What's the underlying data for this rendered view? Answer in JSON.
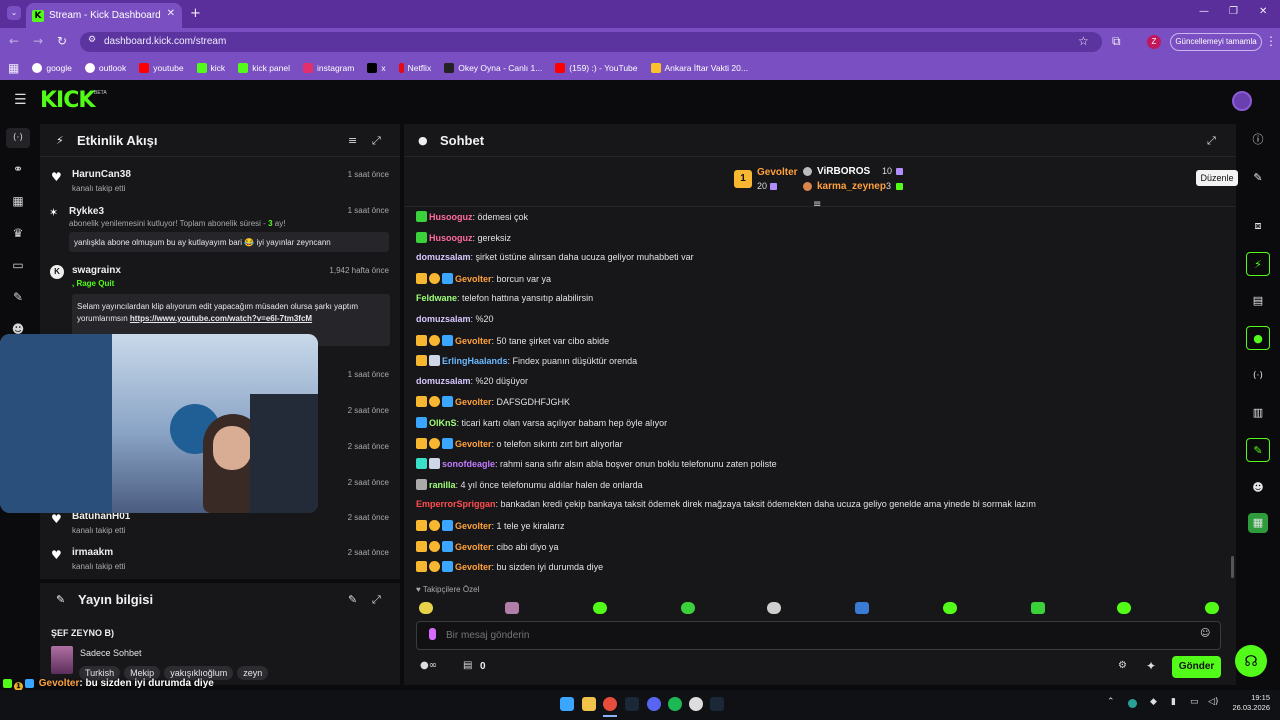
{
  "browser": {
    "tab_title": "Stream - Kick Dashboard",
    "url": "dashboard.kick.com/stream",
    "profile_initial": "Z",
    "update_label": "Güncellemeyi tamamla",
    "bookmarks": [
      "google",
      "outlook",
      "youtube",
      "kick",
      "kick panel",
      "instagram",
      "x",
      "Netflix",
      "Okey Oyna - Canlı 1...",
      "(159) :) - YouTube",
      "Ankara İftar Vakti 20..."
    ]
  },
  "brand": {
    "logo": "KICK",
    "beta": "BETA"
  },
  "activity": {
    "title": "Etkinlik Akışı",
    "events": [
      {
        "name": "HarunCan38",
        "sub": "kanalı takip etti",
        "time": "1 saat önce"
      },
      {
        "name": "Rykke3",
        "sub": "abonelik yenilemesini kutluyor! Toplam abonelik süresi - ",
        "sub_strong": "3",
        "sub_end": " ay!",
        "time": "1 saat önce",
        "message": "yanlışkla abone olmuşum bu ay kutlayayım bari 😂 iyi yayınlar zeyncann"
      },
      {
        "name": "swagrainx",
        "sub": ", Rage Quit",
        "time": "1,942 hafta önce",
        "message": "Selam yayıncılardan klip alıyorum edit yapacağım müsaden olursa şarkı yaptım yorumlarımsın ",
        "link": "https://www.youtube.com/watch?v=e6l-7tm3fcM"
      },
      {
        "time": "1 saat önce"
      },
      {
        "time": "2 saat önce"
      },
      {
        "time": "2 saat önce"
      },
      {
        "time": "2 saat önce"
      },
      {
        "name": "BatuhanH01",
        "sub": "kanalı takip etti",
        "time": "2 saat önce"
      },
      {
        "name": "irmaakm",
        "sub": "kanalı takip etti",
        "time": "2 saat önce"
      }
    ]
  },
  "stream_info": {
    "title": "Yayın bilgisi",
    "stream_title": "ŞEF ZEYNO B)",
    "category": "Sadece Sohbet",
    "tags": [
      "Turkish",
      "Mekip",
      "yakışıklıoğlum",
      "zeyn"
    ]
  },
  "chat": {
    "title": "Sohbet",
    "top": {
      "gifter1": "Gevolter",
      "gifter1_count": "20",
      "rank": "1",
      "gifter2": "ViRBOROS",
      "gifter2_count": "10",
      "gifter3": "karma_zeynep",
      "gifter3_count": "3"
    },
    "messages": [
      {
        "user": "Husooguz",
        "color": "#ff6b9d",
        "text": ": ödemesi çok"
      },
      {
        "user": "Husooguz",
        "color": "#ff6b9d",
        "text": ": gereksiz"
      },
      {
        "user": "domuzsalam",
        "color": "#d8c8ff",
        "text": ": şirket üstüne alırsan daha ucuza geliyor muhabbeti var"
      },
      {
        "user": "Gevolter",
        "color": "#ffa13d",
        "text": ": borcun var ya"
      },
      {
        "user": "Feldwane",
        "color": "#9fff78",
        "text": ": telefon hattına yansıtıp alabilirsin"
      },
      {
        "user": "domuzsalam",
        "color": "#d8c8ff",
        "text": ": %20"
      },
      {
        "user": "Gevolter",
        "color": "#ffa13d",
        "text": ": 50 tane şirket var cibo abide"
      },
      {
        "user": "ErlingHaalands",
        "color": "#6ab8ff",
        "text": ": Findex puanın düşüktür orenda"
      },
      {
        "user": "domuzsalam",
        "color": "#d8c8ff",
        "text": ": %20 düşüyor"
      },
      {
        "user": "Gevolter",
        "color": "#ffa13d",
        "text": ": DAFSGDHFJGHK"
      },
      {
        "user": "OlKnS",
        "color": "#9fff78",
        "text": ": ticari kartı olan varsa açılıyor babam hep öyle alıyor"
      },
      {
        "user": "Gevolter",
        "color": "#ffa13d",
        "text": ": o telefon sıkıntı zırt bırt alıyorlar"
      },
      {
        "user": "sonofdeagle",
        "color": "#c27aff",
        "text": ": rahmi sana sıfır alsın abla boşver onun boklu telefonunu zaten poliste"
      },
      {
        "user": "ranilla",
        "color": "#9fff78",
        "text": ": 4 yıl önce telefonumu aldılar halen de onlarda"
      },
      {
        "user": "EmperrorSpriggan",
        "color": "#ff4d4d",
        "text": ": bankadan kredi çekip bankaya taksit ödemek direk mağzaya taksit ödemekten daha ucuza geliyo genelde ama yinede bi sormak lazım"
      },
      {
        "user": "Gevolter",
        "color": "#ffa13d",
        "text": ": 1 tele ye kiralarız"
      },
      {
        "user": "Gevolter",
        "color": "#ffa13d",
        "text": ": cibo abi diyo ya"
      },
      {
        "user": "Gevolter",
        "color": "#ffa13d",
        "text": ": bu sizden iyi durumda diye"
      }
    ],
    "emote_label": "Takipçilere Özel",
    "input_placeholder": "Bir mesaj gönderin",
    "points": "0",
    "send_label": "Gönder",
    "tooltip": "Düzenle"
  },
  "overlay": {
    "user": "Gevolter",
    "text": ": bu sizden iyi durumda diye",
    "rank": "1"
  },
  "system": {
    "time": "19:15",
    "date": "26.03.2026"
  }
}
